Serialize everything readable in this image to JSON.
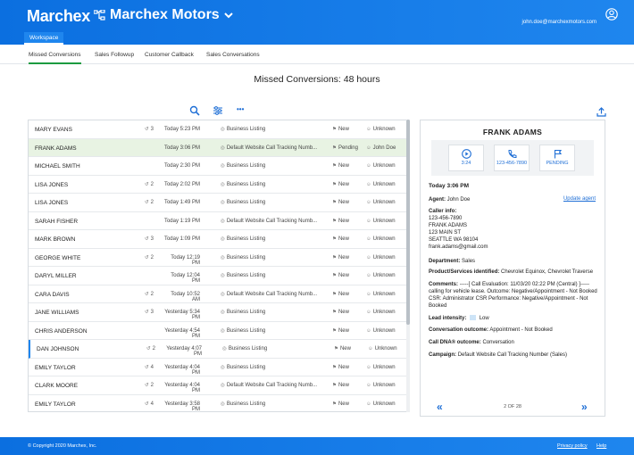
{
  "header": {
    "logo": "Marchex",
    "company": "Marchex Motors",
    "user_email": "john.doe@marchexmotors.com"
  },
  "workspace_tab": "Workspace",
  "subnav": [
    {
      "label": "Missed Conversions",
      "active": true
    },
    {
      "label": "Sales Followup",
      "active": false
    },
    {
      "label": "Customer Callback",
      "active": false
    },
    {
      "label": "Sales Conversations",
      "active": false
    }
  ],
  "page_title": "Missed Conversions: 48 hours",
  "toolbar": {
    "search_icon": "search-icon",
    "filter_icon": "sliders-icon",
    "more_icon": "more-dots-icon",
    "more_label": "•••"
  },
  "calls": [
    {
      "name": "MARY EVANS",
      "count": "3",
      "time": "Today 5:23 PM",
      "source": "Business Listing",
      "status": "New",
      "agent": "Unknown"
    },
    {
      "name": "FRANK ADAMS",
      "count": "",
      "time": "Today 3:06 PM",
      "source": "Default Website Call Tracking Numb...",
      "status": "Pending",
      "agent": "John Doe",
      "selected": true
    },
    {
      "name": "MICHAEL SMITH",
      "count": "",
      "time": "Today 2:30 PM",
      "source": "Business Listing",
      "status": "New",
      "agent": "Unknown"
    },
    {
      "name": "LISA JONES",
      "count": "2",
      "time": "Today 2:02 PM",
      "source": "Business Listing",
      "status": "New",
      "agent": "Unknown"
    },
    {
      "name": "LISA JONES",
      "count": "2",
      "time": "Today 1:49 PM",
      "source": "Business Listing",
      "status": "New",
      "agent": "Unknown"
    },
    {
      "name": "SARAH FISHER",
      "count": "",
      "time": "Today 1:19 PM",
      "source": "Default Website Call Tracking Numb...",
      "status": "New",
      "agent": "Unknown"
    },
    {
      "name": "MARK BROWN",
      "count": "3",
      "time": "Today 1:09 PM",
      "source": "Business Listing",
      "status": "New",
      "agent": "Unknown"
    },
    {
      "name": "GEORGE WHITE",
      "count": "2",
      "time": "Today 12:19 PM",
      "source": "Business Listing",
      "status": "New",
      "agent": "Unknown"
    },
    {
      "name": "DARYL MILLER",
      "count": "",
      "time": "Today 12:04 PM",
      "source": "Business Listing",
      "status": "New",
      "agent": "Unknown"
    },
    {
      "name": "CARA DAVIS",
      "count": "2",
      "time": "Today 10:52 AM",
      "source": "Default Website Call Tracking Numb...",
      "status": "New",
      "agent": "Unknown"
    },
    {
      "name": "JANE WILLIAMS",
      "count": "3",
      "time": "Yesterday 5:34 PM",
      "source": "Business Listing",
      "status": "New",
      "agent": "Unknown"
    },
    {
      "name": "CHRIS ANDERSON",
      "count": "",
      "time": "Yesterday 4:54 PM",
      "source": "Business Listing",
      "status": "New",
      "agent": "Unknown"
    },
    {
      "name": "DAN JOHNSON",
      "count": "2",
      "time": "Yesterday 4:07 PM",
      "source": "Business Listing",
      "status": "New",
      "agent": "Unknown",
      "marked": true
    },
    {
      "name": "EMILY TAYLOR",
      "count": "4",
      "time": "Yesterday 4:04 PM",
      "source": "Business Listing",
      "status": "New",
      "agent": "Unknown"
    },
    {
      "name": "CLARK MOORE",
      "count": "2",
      "time": "Yesterday 4:04 PM",
      "source": "Default Website Call Tracking Numb...",
      "status": "New",
      "agent": "Unknown"
    },
    {
      "name": "EMILY TAYLOR",
      "count": "4",
      "time": "Yesterday 3:58 PM",
      "source": "Business Listing",
      "status": "New",
      "agent": "Unknown"
    }
  ],
  "detail": {
    "name": "FRANK ADAMS",
    "play_label": "3:24",
    "phone_label": "123-456-7890",
    "flag_label": "PENDING",
    "date": "Today 3:06 PM",
    "agent_label": "Agent:",
    "agent": "John Doe",
    "update_agent": "Update agent",
    "caller_info_label": "Caller info:",
    "caller_phone": "123-456-7890",
    "caller_name": "FRANK ADAMS",
    "caller_street": "123 MAIN ST",
    "caller_city": "SEATTLE WA 98104",
    "caller_email": "frank.adams@gmail.com",
    "department_label": "Department:",
    "department": "Sales",
    "products_label": "Product/Services identified:",
    "products": "Chevrolet Equinox, Chevrolet Traverse",
    "comments_label": "Comments:",
    "comments_1": "-----[ Call Evaluation: 11/03/20 02:22 PM (Central) ]-----",
    "comments_2": "calling for vehicle lease. Outcome: Negative/Appointment - Not Booked",
    "comments_3": "CSR: Administrator CSR Performance: Negative/Appointment - Not",
    "comments_4": "Booked",
    "lead_label": "Lead intensity:",
    "lead": "Low",
    "conv_label": "Conversation outcome:",
    "conv": "Appointment - Not Booked",
    "dna_label": "Call DNA® outcome:",
    "dna": "Conversation",
    "campaign_label": "Campaign:",
    "campaign": "Default Website Call Tracking Number (Sales)",
    "pager": "2 OF 28",
    "prev": "«",
    "next": "»"
  },
  "footer": {
    "copyright": "© Copyright 2020 Marchex, Inc.",
    "privacy": "Privacy policy",
    "help": "Help"
  },
  "colors": {
    "brand_blue": "#1f86ee",
    "selected_row": "#e8f3e3",
    "active_tab_underline": "#1b9b40"
  }
}
